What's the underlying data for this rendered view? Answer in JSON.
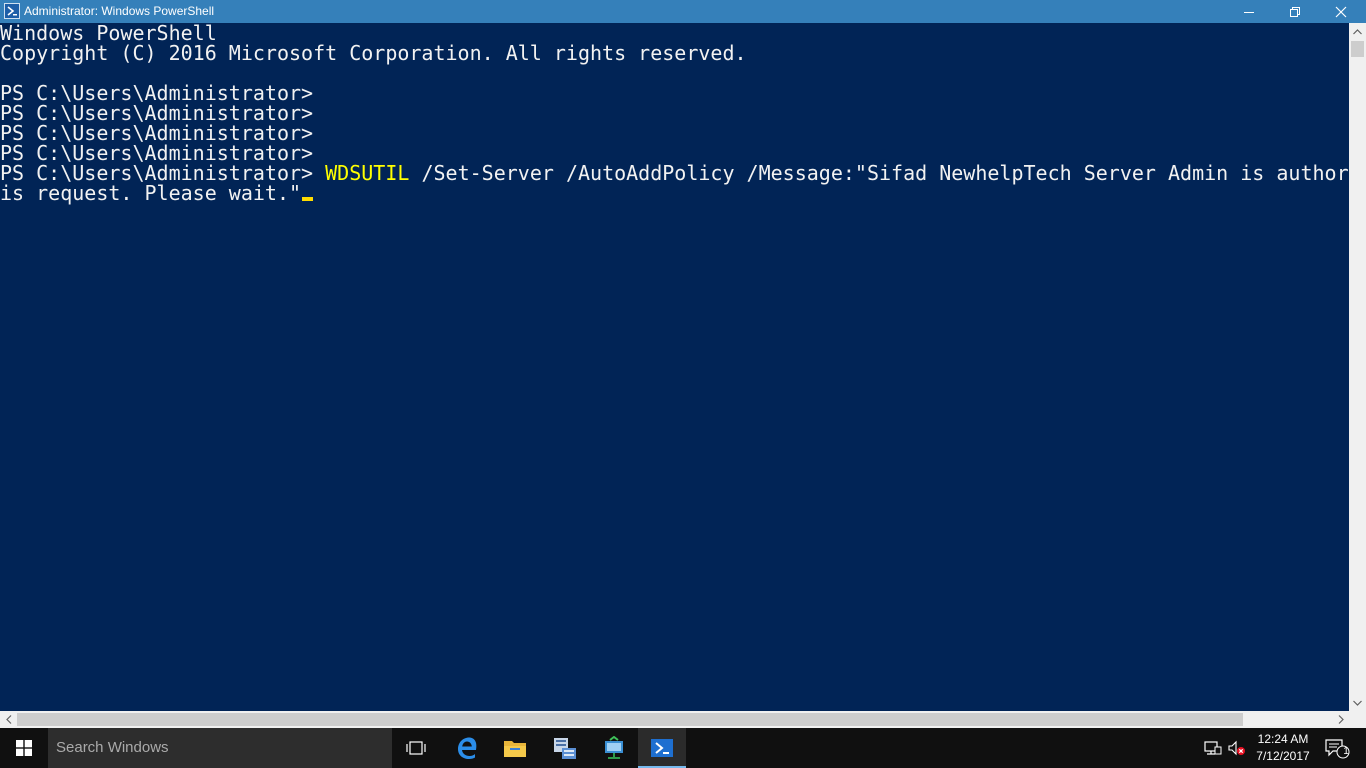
{
  "window": {
    "title": "Administrator: Windows PowerShell",
    "icon": "powershell-icon"
  },
  "console": {
    "lines": [
      "Windows PowerShell",
      "Copyright (C) 2016 Microsoft Corporation. All rights reserved.",
      "",
      "PS C:\\Users\\Administrator>",
      "PS C:\\Users\\Administrator>",
      "PS C:\\Users\\Administrator>",
      "PS C:\\Users\\Administrator>"
    ],
    "current": {
      "prompt": "PS C:\\Users\\Administrator> ",
      "command": "WDSUTIL",
      "args": " /Set-Server /AutoAddPolicy /Message:\"Sifad NewhelpTech Server Admin is author",
      "wrap": "is request. Please wait.\""
    },
    "colors": {
      "background": "#012456",
      "text": "#f2f2f2",
      "command": "#ffff00",
      "cursor": "#ffdc00"
    }
  },
  "taskbar": {
    "search_placeholder": "Search Windows",
    "apps": [
      "task-view-icon",
      "edge-icon",
      "file-explorer-icon",
      "server-manager-icon",
      "network-icon",
      "powershell-icon"
    ],
    "tray": {
      "time": "12:24 AM",
      "date": "7/12/2017",
      "notification_count": "1"
    }
  }
}
